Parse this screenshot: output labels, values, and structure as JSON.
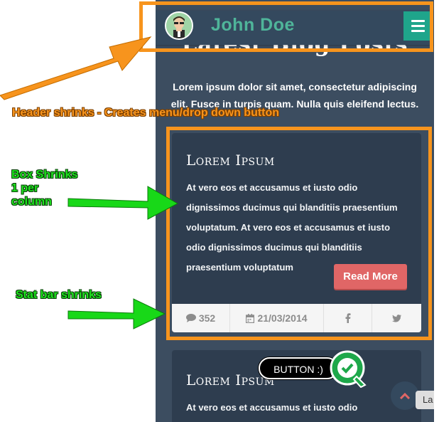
{
  "header": {
    "name": "John Doe",
    "menu_icon": "hamburger-icon"
  },
  "page": {
    "blog_title": "Latest Blog Posts",
    "intro": "Lorem ipsum dolor sit amet, consectetur adipiscing elit. Fusce in turpis quam. Nulla quis eleifend lectus."
  },
  "posts": [
    {
      "title": "Lorem Ipsum",
      "body": "At vero eos et accusamus et iusto odio dignissimos ducimus qui blanditiis praesentium voluptatum. At vero eos et accusamus et iusto odio dignissimos ducimus qui blanditiis praesentium voluptatum",
      "read_more": "Read More",
      "comments": "352",
      "date": "21/03/2014",
      "share_icons": [
        "facebook-icon",
        "twitter-icon"
      ]
    },
    {
      "title": "Lorem Ipsum",
      "body": "At vero eos et accusamus et iusto odio dignissimos"
    }
  ],
  "scroll_top_icon": "chevron-up-icon",
  "lang_tab": "La",
  "annotations": {
    "header_note": "Header shrinks - Creates menu/drop down button",
    "box_note": "Box Shrinks\n1 per\ncolumn",
    "stat_note": "Stat bar shrinks",
    "bubble": "BUTTON :)"
  },
  "colors": {
    "annotation_orange": "#f7941d",
    "annotation_green": "#1ee21e",
    "accent_teal": "#1fa58b",
    "button_red": "#e06666",
    "background": "#3c4d60"
  }
}
